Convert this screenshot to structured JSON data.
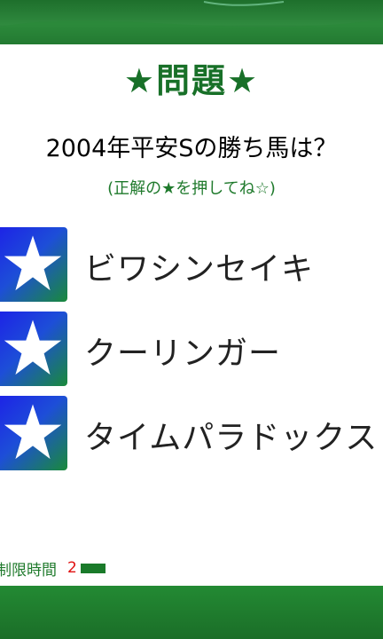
{
  "quiz": {
    "title": "★問題★",
    "question": "2004年平安Sの勝ち馬は？",
    "hint": "(正解の★を押してね☆)",
    "answers": [
      {
        "label": "ビワシンセイキ"
      },
      {
        "label": "クーリンガー"
      },
      {
        "label": "タイムパラドックス"
      }
    ]
  },
  "timer": {
    "label": "制限時間",
    "count": "2",
    "remaining_fraction": 0.1
  },
  "colors": {
    "header_green": "#1e6f2c",
    "title_green": "#187028",
    "button_blue": "#1d24e6",
    "button_green": "#1a8a3a",
    "timer_red": "#e01010"
  },
  "icons": {
    "answer_button_icon": "star-icon"
  }
}
